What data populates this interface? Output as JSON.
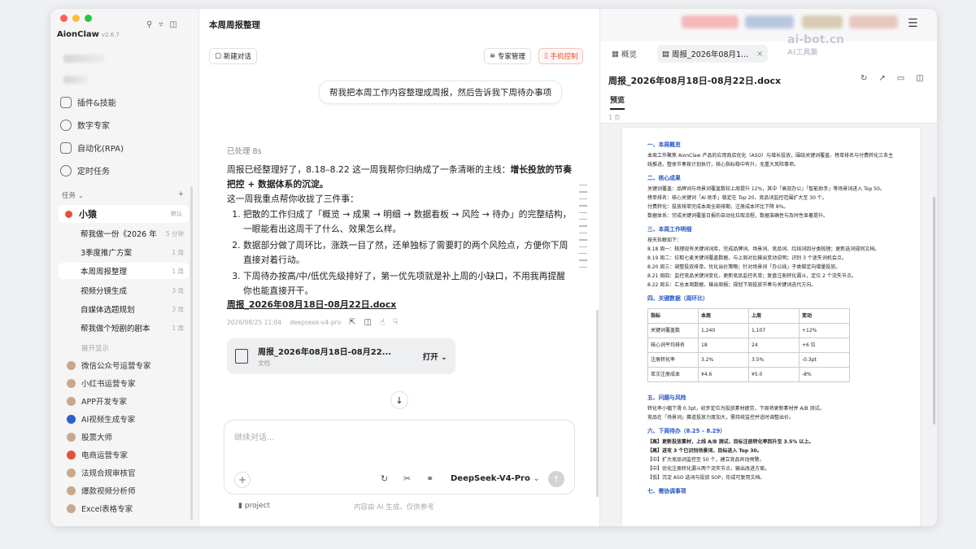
{
  "app": {
    "name": "AionClaw",
    "version": "v2.6.7"
  },
  "sidebar": {
    "nav": [
      {
        "label": "插件&技能"
      },
      {
        "label": "数字专家"
      },
      {
        "label": "自动化(RPA)"
      },
      {
        "label": "定时任务"
      }
    ],
    "tasks_header": "任务",
    "add_symbol": "+",
    "group": {
      "name": "小猿",
      "tag": "默认"
    },
    "tasks": [
      {
        "label": "帮我做一份《2026 年",
        "time": "5 分钟"
      },
      {
        "label": "3季度推广方案",
        "time": "1 周"
      },
      {
        "label": "本周周报整理",
        "time": "1 周"
      },
      {
        "label": "视频分镜生成",
        "time": "3 周"
      },
      {
        "label": "自媒体选题规划",
        "time": "3 周"
      },
      {
        "label": "帮我做个短剧的剧本",
        "time": "1 周"
      }
    ],
    "expand": "展开显示",
    "experts": [
      {
        "label": "微信公众号运营专家"
      },
      {
        "label": "小红书运营专家"
      },
      {
        "label": "APP开发专家"
      },
      {
        "label": "AI视频生成专家"
      },
      {
        "label": "股票大师"
      },
      {
        "label": "电商运营专家"
      },
      {
        "label": "法规合规审核官"
      },
      {
        "label": "爆款视频分析师"
      },
      {
        "label": "Excel表格专家"
      }
    ]
  },
  "chat": {
    "title": "本周周报整理",
    "new_chat": "新建对话",
    "expert_mgmt": "专家管理",
    "phone_control": "手机控制",
    "user_message": "帮我把本周工作内容整理成周报，然后告诉我下周待办事项",
    "processed": "已处理 8s",
    "reply_intro_1": "周报已经整理好了，8.18–8.22 这一周我帮你归纳成了一条清晰的主线：",
    "reply_intro_bold": "增长投放的节奏把控 + 数据体系的沉淀。",
    "reply_intro_2": "这一周我重点帮你收拢了三件事：",
    "reply_points": [
      "把散的工作归成了「概览 → 成果 → 明细 → 数据看板 → 风险 → 待办」的完整结构，一眼能看出这周干了什么、效果怎么样。",
      "数据部分做了周环比，涨跌一目了然，还单独标了需要盯的两个风险点，方便你下周直接对着行动。",
      "下周待办按高/中/低优先级排好了，第一优先项就是补上周的小缺口，不用我再提醒你也能直接开干。"
    ],
    "file_link": "周报_2026年08月18日-08月22日.docx",
    "meta_time": "2026/08/25 11:04",
    "meta_model": "deepseek-v4-pro",
    "file_card": {
      "name": "周报_2026年08月18日-08月22...",
      "sub": "文档",
      "open": "打开"
    },
    "input_placeholder": "继续对话...",
    "model": "DeepSeek-V4-Pro",
    "project": "project",
    "ai_notice": "内容由 AI 生成，仅供参考"
  },
  "right": {
    "tab_overview": "概览",
    "tab_file": "周报_2026年08月1...",
    "watermark": "ai-bot.cn",
    "watermark_sub": "AI工具集",
    "doc_title": "周报_2026年08月18日-08月22日.docx",
    "preview": "预览",
    "pages": "1 页",
    "doc": {
      "s1": "一、本周概览",
      "s1_text": "本周工作聚焦 AionClaw 产品的应用商店优化（ASO）与增长投放，围绕关键词覆盖、榜单排名与付费转化三条主线推进。整体节奏按计划执行，核心指标稳中有升，无重大风险事项。",
      "s2": "二、核心成果",
      "s2_lines": [
        "关键词覆盖：品牌词与场景词覆盖数较上周提升 12%，其中「高效办公」「智能助手」等场景词进入 Top 50。",
        "榜单排名：核心关键词「AI 助手」稳定在 Top 20，竞品词监控范围扩大至 30 个。",
        "付费转化：投放排单完成本周全部排期，注册成本环比下降 8%。",
        "数据体系：完成关键词覆盖日报的自动化拉取流程，数据准确性与及时性显著提升。"
      ],
      "s3": "三、本周工作明细",
      "s3_intro": "按天拆解如下：",
      "s3_lines": [
        "8.18 周一：梳理现有关键词词库，完成品牌词、场景词、竞品词、红线词四分类梳理；更新选词规则文档。",
        "8.19 周二：拉取七麦关键词覆盖数据，与上周对比输出变动说明；识别 3 个迷失词机会点。",
        "8.20 周三：调整投放排单，优化出价策略；针对场景词「办公线」子类做定向增量投放。",
        "8.21 周四：监控竞品关键词变化，更新竞品监控名单；复盘注册转化漏斗，定位 2 个流失节点。",
        "8.22 周五：汇总本周数据，输出周报；规划下周投放节奏与关键词迭代方向。"
      ],
      "s4": "四、关键数据（周环比）",
      "table": [
        [
          "指标",
          "本周",
          "上周",
          "变动"
        ],
        [
          "关键词覆盖数",
          "1,240",
          "1,107",
          "+12%"
        ],
        [
          "核心词平均排名",
          "18",
          "24",
          "+6 位"
        ],
        [
          "注册转化率",
          "3.2%",
          "3.5%",
          "-0.3pt"
        ],
        [
          "单次注册成本",
          "¥4.6",
          "¥5.0",
          "-8%"
        ]
      ],
      "s5": "五、问题与风险",
      "s5_lines": [
        "转化率小幅下滑 0.3pt，初步定位为投放素材疲劳，下周将更新素材并 A/B 测试。",
        "竞品在「场景词」赛道投放力度加大，需持续监控并适时调整出价。"
      ],
      "s6": "六、下周待办（8.25 – 8.29）",
      "s6_lines": [
        "【高】更新投放素材，上线 A/B 测试，目标注册转化率回升至 3.5% 以上。",
        "【高】进攻 3 个已识别场景词，目标进入 Top 30。",
        "【中】扩大竞品词监控至 50 个，建立竞品异动预警。",
        "【中】优化注册转化漏斗两个流失节点，输出改进方案。",
        "【低】沉淀 ASO 选词与投放 SOP，形成可复用文档。"
      ],
      "s7": "七、需协调事项"
    }
  },
  "colors": {
    "accent_red": "#e5513a",
    "heading_blue": "#2458c4"
  }
}
